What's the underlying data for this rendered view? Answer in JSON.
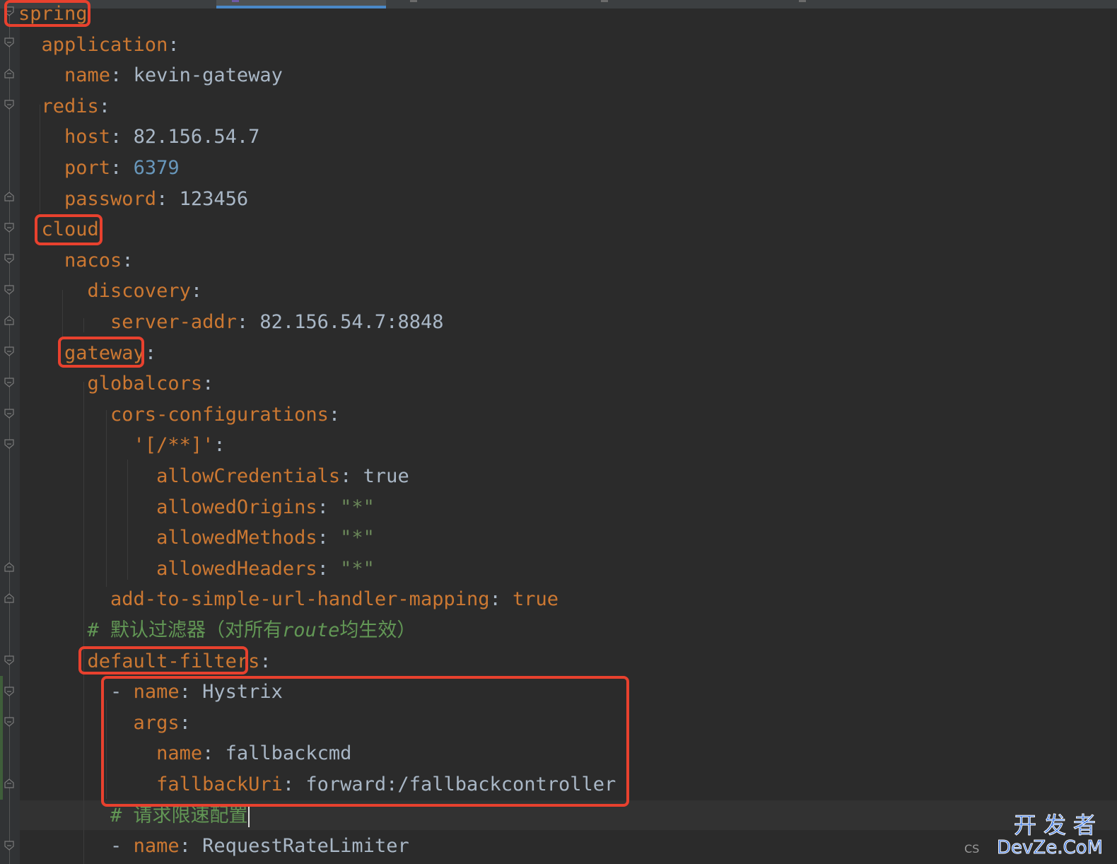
{
  "lines": [
    [
      {
        "t": "spring",
        "c": "k"
      }
    ],
    [
      {
        "t": "  application",
        "c": "k"
      },
      {
        "t": ":",
        "c": "p"
      }
    ],
    [
      {
        "t": "    name",
        "c": "k"
      },
      {
        "t": ": ",
        "c": "p"
      },
      {
        "t": "kevin-gateway",
        "c": "v"
      }
    ],
    [
      {
        "t": "  redis",
        "c": "k"
      },
      {
        "t": ":",
        "c": "p"
      }
    ],
    [
      {
        "t": "    host",
        "c": "k"
      },
      {
        "t": ": ",
        "c": "p"
      },
      {
        "t": "82.156.54.7",
        "c": "v"
      }
    ],
    [
      {
        "t": "    port",
        "c": "k"
      },
      {
        "t": ": ",
        "c": "p"
      },
      {
        "t": "6379",
        "c": "n"
      }
    ],
    [
      {
        "t": "    password",
        "c": "k"
      },
      {
        "t": ": ",
        "c": "p"
      },
      {
        "t": "123456",
        "c": "v"
      }
    ],
    [
      {
        "t": "  cloud",
        "c": "k"
      }
    ],
    [
      {
        "t": "    nacos",
        "c": "k"
      },
      {
        "t": ":",
        "c": "p"
      }
    ],
    [
      {
        "t": "      discovery",
        "c": "k"
      },
      {
        "t": ":",
        "c": "p"
      }
    ],
    [
      {
        "t": "        server-addr",
        "c": "k"
      },
      {
        "t": ": ",
        "c": "p"
      },
      {
        "t": "82.156.54.7:8848",
        "c": "v"
      }
    ],
    [
      {
        "t": "    gateway",
        "c": "k"
      },
      {
        "t": ":",
        "c": "p"
      }
    ],
    [
      {
        "t": "      globalcors",
        "c": "k"
      },
      {
        "t": ":",
        "c": "p"
      }
    ],
    [
      {
        "t": "        cors-configurations",
        "c": "k"
      },
      {
        "t": ":",
        "c": "p"
      }
    ],
    [
      {
        "t": "          '[/**]'",
        "c": "k"
      },
      {
        "t": ":",
        "c": "p"
      }
    ],
    [
      {
        "t": "            allowCredentials",
        "c": "k"
      },
      {
        "t": ": ",
        "c": "p"
      },
      {
        "t": "true",
        "c": "v"
      }
    ],
    [
      {
        "t": "            allowedOrigins",
        "c": "k"
      },
      {
        "t": ": ",
        "c": "p"
      },
      {
        "t": "\"*\"",
        "c": "s"
      }
    ],
    [
      {
        "t": "            allowedMethods",
        "c": "k"
      },
      {
        "t": ": ",
        "c": "p"
      },
      {
        "t": "\"*\"",
        "c": "s"
      }
    ],
    [
      {
        "t": "            allowedHeaders",
        "c": "k"
      },
      {
        "t": ": ",
        "c": "p"
      },
      {
        "t": "\"*\"",
        "c": "s"
      }
    ],
    [
      {
        "t": "        add-to-simple-url-handler-mapping",
        "c": "k"
      },
      {
        "t": ": ",
        "c": "p"
      },
      {
        "t": "true",
        "c": "k"
      }
    ],
    [
      {
        "t": "      # 默认过滤器（对所有",
        "c": "c"
      },
      {
        "t": "route",
        "c": "c c-ital"
      },
      {
        "t": "均生效）",
        "c": "c"
      }
    ],
    [
      {
        "t": "      default-filters",
        "c": "k"
      },
      {
        "t": ":",
        "c": "p"
      }
    ],
    [
      {
        "t": "        - ",
        "c": "p"
      },
      {
        "t": "name",
        "c": "k"
      },
      {
        "t": ": ",
        "c": "p"
      },
      {
        "t": "Hystrix",
        "c": "v"
      }
    ],
    [
      {
        "t": "          args",
        "c": "k"
      },
      {
        "t": ":",
        "c": "p"
      }
    ],
    [
      {
        "t": "            name",
        "c": "k"
      },
      {
        "t": ": ",
        "c": "p"
      },
      {
        "t": "fallbackcmd",
        "c": "v"
      }
    ],
    [
      {
        "t": "            fallbackUri",
        "c": "k"
      },
      {
        "t": ": ",
        "c": "p"
      },
      {
        "t": "forward:/fallbackcontroller",
        "c": "v"
      }
    ],
    [
      {
        "t": "        # 请求限速配置",
        "c": "c"
      }
    ],
    [
      {
        "t": "        - ",
        "c": "p"
      },
      {
        "t": "name",
        "c": "k"
      },
      {
        "t": ": ",
        "c": "p"
      },
      {
        "t": "RequestRateLimiter",
        "c": "v"
      }
    ]
  ],
  "watermark": {
    "cn": "开发者",
    "en": "DevZe.CoM",
    "cs": "CS"
  }
}
